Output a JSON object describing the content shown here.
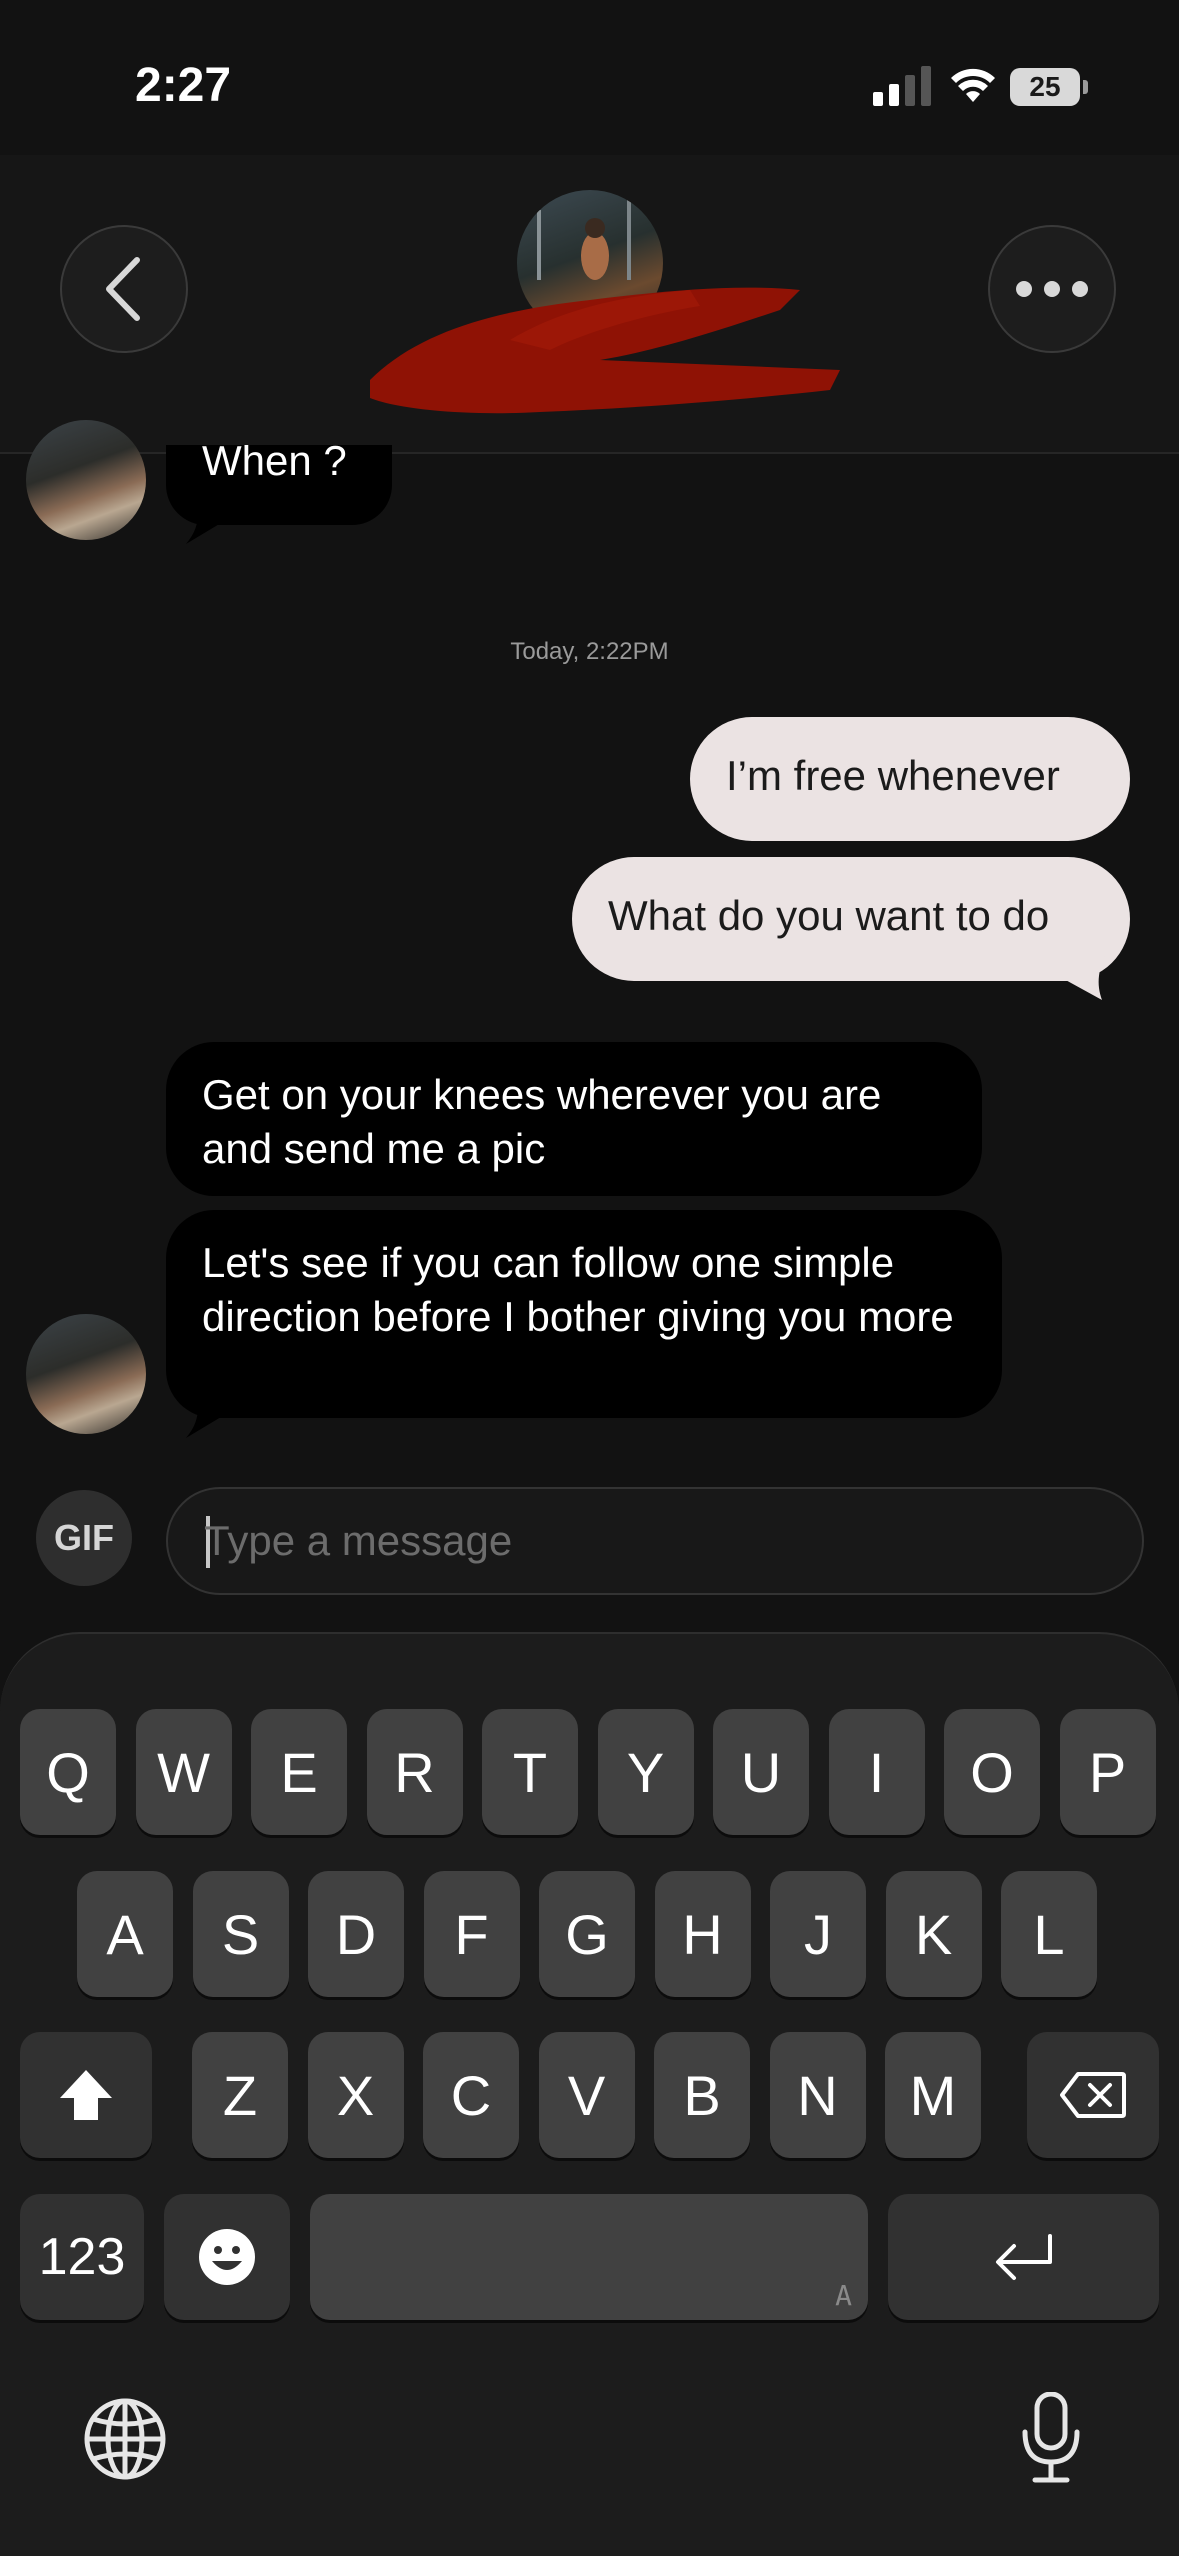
{
  "status_bar": {
    "time": "2:27",
    "battery": "25"
  },
  "header": {
    "contact_name_redacted": true
  },
  "messages": {
    "prev_incoming": "When ?",
    "timestamp": "Today, 2:22PM",
    "outgoing": [
      "I’m free whenever",
      "What do you want to do"
    ],
    "incoming": [
      "Get on your knees wherever you are and send me a pic",
      "Let's see if you can follow one simple direction before I bother giving you more"
    ]
  },
  "composer": {
    "gif_label": "GIF",
    "placeholder": "Type a message"
  },
  "keyboard": {
    "row1": [
      "Q",
      "W",
      "E",
      "R",
      "T",
      "Y",
      "U",
      "I",
      "O",
      "P"
    ],
    "row2": [
      "A",
      "S",
      "D",
      "F",
      "G",
      "H",
      "J",
      "K",
      "L"
    ],
    "row3": [
      "Z",
      "X",
      "C",
      "V",
      "B",
      "N",
      "M"
    ],
    "numbers_label": "123",
    "space_hint": "A"
  }
}
